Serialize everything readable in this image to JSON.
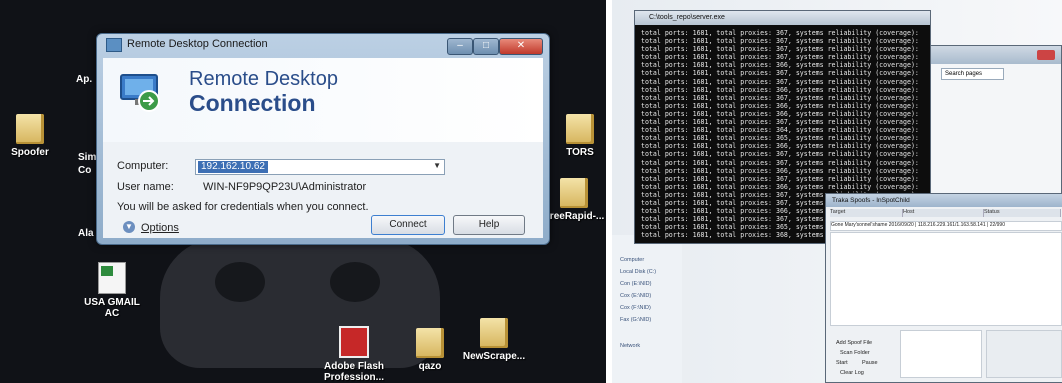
{
  "left_screen": {
    "desktop_icons": [
      {
        "label": "Spoofer"
      },
      {
        "label": "TORS"
      },
      {
        "label": "FreeRapid-..."
      },
      {
        "label": "USA GMAIL AC"
      },
      {
        "label": "Adobe Flash Profession..."
      },
      {
        "label": "qazo"
      },
      {
        "label": "NewScrape..."
      }
    ],
    "partial_labels": [
      "Ap.",
      "Sim",
      "Co",
      "Ala"
    ],
    "rdc": {
      "title": "Remote Desktop Connection",
      "banner_line1": "Remote Desktop",
      "banner_line2": "Connection",
      "computer_label": "Computer:",
      "computer_value": "192.162.10.62",
      "username_label": "User name:",
      "username_value": "WIN-NF9P9QP23U\\Administrator",
      "credentials_note": "You will be asked for credentials when you connect.",
      "options_label": "Options",
      "connect_label": "Connect",
      "help_label": "Help"
    }
  },
  "right_screen": {
    "console": {
      "title": "C:\\tools_repo\\server.exe",
      "lines": [
        "total ports: 1681, total proxies: 367, systems reliability (coverage): 22%",
        "total ports: 1681, total proxies: 367, systems reliability (coverage): 22%",
        "total ports: 1681, total proxies: 367, systems reliability (coverage): 22%",
        "total ports: 1681, total proxies: 367, systems reliability (coverage): 22%",
        "total ports: 1681, total proxies: 366, systems reliability (coverage): 22%",
        "total ports: 1681, total proxies: 367, systems reliability (coverage): 22%",
        "total ports: 1681, total proxies: 367, systems reliability (coverage): 22%",
        "total ports: 1681, total proxies: 366, systems reliability (coverage): 22%",
        "total ports: 1681, total proxies: 367, systems reliability (coverage): 22%",
        "total ports: 1681, total proxies: 366, systems reliability (coverage): 22%",
        "total ports: 1681, total proxies: 366, systems reliability (coverage): 22%",
        "total ports: 1681, total proxies: 367, systems reliability (coverage): 22%",
        "total ports: 1681, total proxies: 364, systems reliability (coverage): 22%",
        "total ports: 1681, total proxies: 365, systems reliability (coverage): 22%",
        "total ports: 1681, total proxies: 366, systems reliability (coverage): 22%",
        "total ports: 1681, total proxies: 367, systems reliability (coverage): 22%",
        "total ports: 1681, total proxies: 367, systems reliability (coverage): 22%",
        "total ports: 1681, total proxies: 366, systems reliability (coverage): 22%",
        "total ports: 1681, total proxies: 367, systems reliability (coverage): 22%",
        "total ports: 1681, total proxies: 366, systems reliability (coverage): 22%",
        "total ports: 1681, total proxies: 367, systems reliability (coverage): 22%",
        "total ports: 1681, total proxies: 367, systems reliability (coverage): 22%",
        "total ports: 1681, total proxies: 366, systems reliability (coverage): 22%",
        "total ports: 1681, total proxies: 367, systems reliability (coverage): 22%",
        "total ports: 1681, total proxies: 365, systems reliability (coverage): 22%",
        "total ports: 1681, total proxies: 368, systems reliability (coverage): 22%"
      ]
    },
    "browser": {
      "search_placeholder": "Search pages"
    },
    "traka": {
      "title": "Traka Spoofs - InSpotChild",
      "col1": "Target",
      "col2": "Host",
      "col3": "Status",
      "row_text": "Gone Mary'sonnel'shame 2016/09/20 | 118.216.229.161/1.163.58.141 | 22/990",
      "add_label": "Add Spoof File",
      "scan_label": "Scan Folder",
      "start_label": "Start",
      "pause_label": "Pause",
      "clear_label": "Clear Log"
    },
    "sidebar": [
      "Computer",
      "Local Disk (C:)",
      "Con (E:\\NID)",
      "Cox (E:\\NID)",
      "Cox (F:\\NID)",
      "Fax (G:\\NID)",
      "Network"
    ]
  }
}
